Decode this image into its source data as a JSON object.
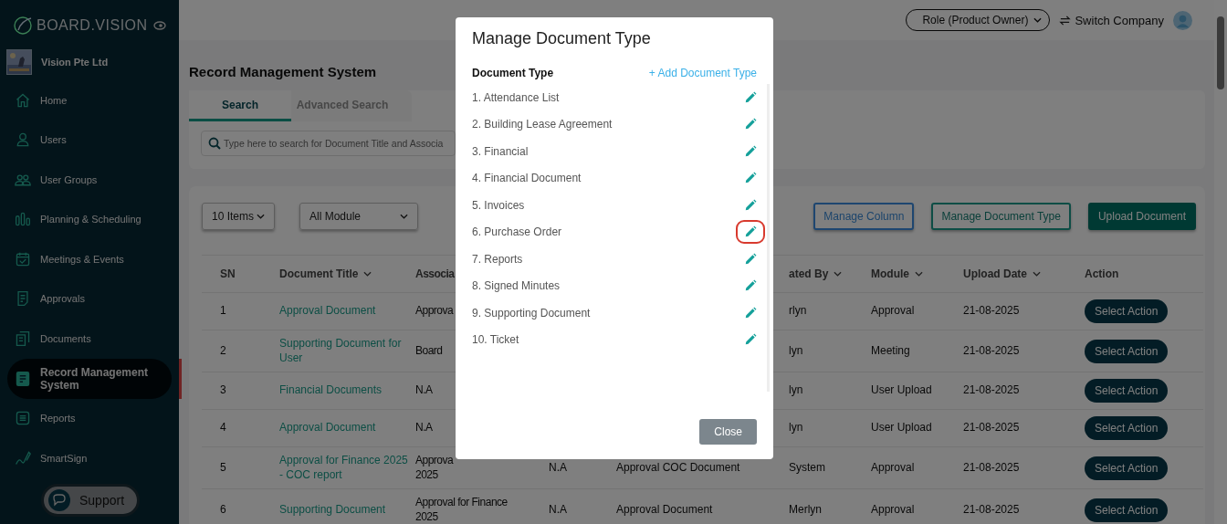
{
  "sidebar": {
    "logo": "BOARD.VISION",
    "company": "Vision Pte Ltd",
    "items": [
      {
        "label": "Home",
        "selected": false
      },
      {
        "label": "Users",
        "selected": false
      },
      {
        "label": "User Groups",
        "selected": false
      },
      {
        "label": "Planning & Scheduling",
        "selected": false
      },
      {
        "label": "Meetings & Events",
        "selected": false
      },
      {
        "label": "Approvals",
        "selected": false
      },
      {
        "label": "Documents",
        "selected": false
      },
      {
        "label": "Record Management System",
        "selected": true
      },
      {
        "label": "Reports",
        "selected": false
      },
      {
        "label": "SmartSign",
        "selected": false
      }
    ],
    "support": "Support"
  },
  "header": {
    "role": "Role (Product Owner)",
    "switch": "Switch Company"
  },
  "page_title": "Record Management System",
  "tabs": [
    {
      "label": "Search",
      "selected": true
    },
    {
      "label": "Advanced Search",
      "selected": false
    }
  ],
  "search": {
    "placeholder": "Type here to search for Document Title and Associa"
  },
  "filters": [
    "10 Items",
    "All Module"
  ],
  "buttons": [
    {
      "label": "Manage Column",
      "kind": "outline-blue"
    },
    {
      "label": "Manage Document Type",
      "kind": "outline-teal"
    },
    {
      "label": "Upload Document",
      "kind": "filled"
    }
  ],
  "table": {
    "columns": [
      {
        "label": "SN",
        "sortable": false
      },
      {
        "label": "Document Title",
        "sortable": true
      },
      {
        "label": "Associa"
      },
      null,
      null,
      {
        "label": "ated By",
        "sortable": true
      },
      {
        "label": "Module",
        "sortable": true
      },
      {
        "label": "Upload Date",
        "sortable": true
      },
      {
        "label": "Action",
        "sortable": false
      }
    ],
    "rows": [
      {
        "cells": [
          "1",
          "Approval Document",
          "Approva",
          null,
          null,
          "rlyn",
          "Approval",
          "21-08-2025"
        ],
        "action": "Select Action"
      },
      {
        "cells": [
          "2",
          "Supporting Document for User",
          "Board",
          null,
          null,
          "lyn",
          "Meeting",
          "21-08-2025"
        ],
        "action": "Select Action"
      },
      {
        "cells": [
          "3",
          "Financial Documents",
          "N.A",
          null,
          null,
          "lyn",
          "User Upload",
          "21-08-2025"
        ],
        "action": "Select Action"
      },
      {
        "cells": [
          "4",
          "Approval Document",
          "N.A",
          null,
          null,
          "lyn",
          "User Upload",
          "21-08-2025"
        ],
        "action": "Select Action"
      },
      {
        "cells": [
          "5",
          "Approval for Finance 2025 - COC report",
          "Approva\n2025",
          "N.A",
          "Approval COC Document",
          "System",
          "Approval",
          "21-08-2025"
        ],
        "action": "Select Action"
      },
      {
        "cells": [
          "6",
          "Supporting Document",
          "Approval for Finance\n2025",
          "N.A",
          "Approval Document",
          "Merlyn",
          "Approval",
          "21-08-2025"
        ],
        "action": "Select Action"
      }
    ]
  },
  "modal": {
    "title": "Manage Document Type",
    "list_header": "Document Type",
    "add_link": "+ Add Document Type",
    "items": [
      {
        "label": "1. Attendance List",
        "highlighted": false
      },
      {
        "label": "2. Building Lease Agreement",
        "highlighted": false
      },
      {
        "label": "3. Financial",
        "highlighted": false
      },
      {
        "label": "4. Financial Document",
        "highlighted": false
      },
      {
        "label": "5. Invoices",
        "highlighted": false
      },
      {
        "label": "6. Purchase Order",
        "highlighted": true
      },
      {
        "label": "7. Reports",
        "highlighted": false
      },
      {
        "label": "8. Signed Minutes",
        "highlighted": false
      },
      {
        "label": "9. Supporting Document",
        "highlighted": false
      },
      {
        "label": "10. Ticket",
        "highlighted": false
      }
    ],
    "close": "Close"
  }
}
